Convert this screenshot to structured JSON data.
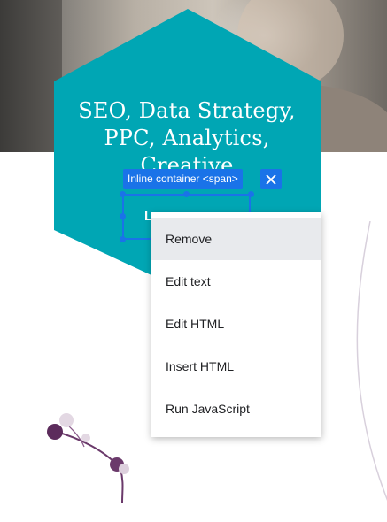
{
  "hero": {
    "title": "SEO, Data Strategy, PPC, Analytics, Creative",
    "button_text": "L",
    "accent_color": "#00a6b4"
  },
  "inline_container": {
    "label": "Inline container <span>",
    "close_icon": "close-icon",
    "highlight_color": "#1a73e8"
  },
  "context_menu": {
    "items": [
      {
        "label": "Remove"
      },
      {
        "label": "Edit text"
      },
      {
        "label": "Edit HTML"
      },
      {
        "label": "Insert HTML"
      },
      {
        "label": "Run JavaScript"
      }
    ]
  }
}
